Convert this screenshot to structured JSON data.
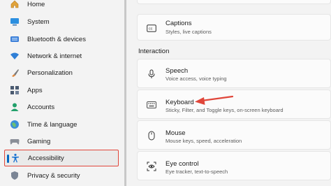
{
  "sidebar": {
    "items": [
      {
        "label": "Home",
        "icon": "home-icon"
      },
      {
        "label": "System",
        "icon": "system-icon"
      },
      {
        "label": "Bluetooth & devices",
        "icon": "bluetooth-icon"
      },
      {
        "label": "Network & internet",
        "icon": "wifi-icon"
      },
      {
        "label": "Personalization",
        "icon": "brush-icon"
      },
      {
        "label": "Apps",
        "icon": "apps-icon"
      },
      {
        "label": "Accounts",
        "icon": "person-icon"
      },
      {
        "label": "Time & language",
        "icon": "globe-icon"
      },
      {
        "label": "Gaming",
        "icon": "controller-icon"
      },
      {
        "label": "Accessibility",
        "icon": "accessibility-icon",
        "selected": true
      },
      {
        "label": "Privacy & security",
        "icon": "shield-icon"
      }
    ]
  },
  "main": {
    "captions": {
      "title": "Captions",
      "subtitle": "Styles, live captions"
    },
    "section_interaction": "Interaction",
    "speech": {
      "title": "Speech",
      "subtitle": "Voice access, voice typing"
    },
    "keyboard": {
      "title": "Keyboard",
      "subtitle": "Sticky, Filter, and Toggle keys, on-screen keyboard"
    },
    "mouse": {
      "title": "Mouse",
      "subtitle": "Mouse keys, speed, acceleration"
    },
    "eye_control": {
      "title": "Eye control",
      "subtitle": "Eye tracker, text-to-speech"
    }
  },
  "colors": {
    "accent": "#0067c0",
    "highlight_box": "#e0463a",
    "arrow": "#e0463a"
  }
}
